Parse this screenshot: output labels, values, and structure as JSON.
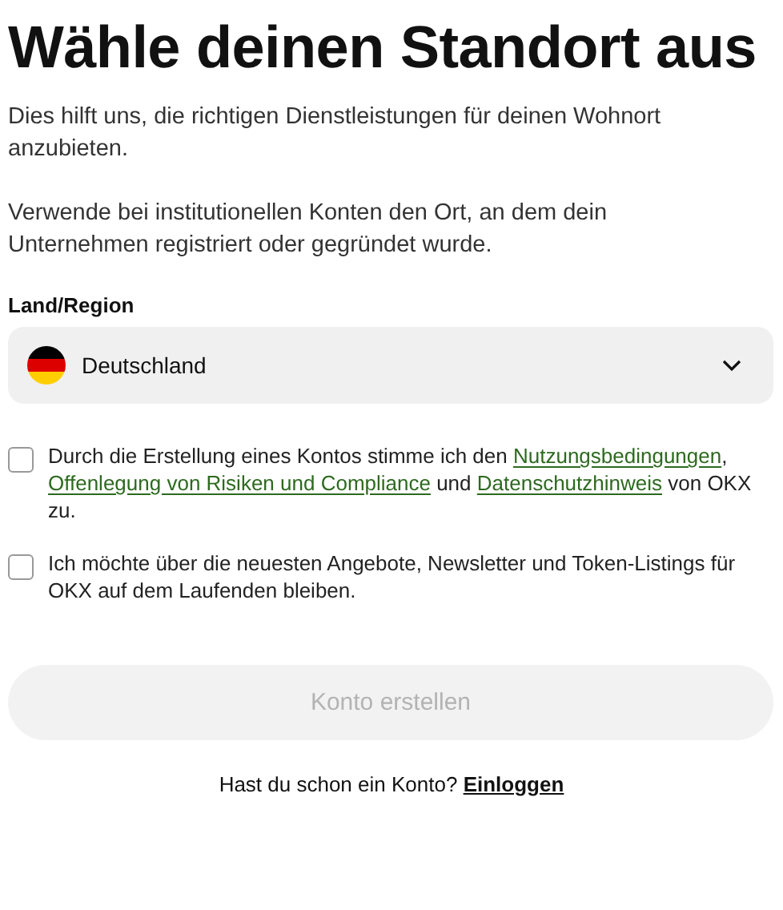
{
  "heading": "Wähle deinen Standort aus",
  "paragraphs": [
    "Dies hilft uns, die richtigen Dienstleistungen für deinen Wohnort anzubieten.",
    "Verwende bei institutionellen Konten den Ort, an dem dein Unternehmen registriert oder gegründet wurde."
  ],
  "region": {
    "label": "Land/Region",
    "value": "Deutschland"
  },
  "checkboxes": [
    {
      "checked": false,
      "parts": [
        {
          "kind": "text",
          "text": "Durch die Erstellung eines Kontos stimme ich den "
        },
        {
          "kind": "link",
          "text": "Nutzungsbedingungen"
        },
        {
          "kind": "text",
          "text": ", "
        },
        {
          "kind": "link",
          "text": "Offenlegung von Risiken und Compliance"
        },
        {
          "kind": "text",
          "text": " und "
        },
        {
          "kind": "link",
          "text": "Datenschutzhinweis"
        },
        {
          "kind": "text",
          "text": " von OKX zu."
        }
      ]
    },
    {
      "checked": false,
      "parts": [
        {
          "kind": "text",
          "text": "Ich möchte über die neuesten Angebote, Newsletter und Token-Listings für OKX auf dem Laufenden bleiben."
        }
      ]
    }
  ],
  "submit": {
    "label": "Konto erstellen",
    "disabled": true
  },
  "footer": {
    "text": "Hast du schon ein Konto?",
    "link": "Einloggen"
  }
}
